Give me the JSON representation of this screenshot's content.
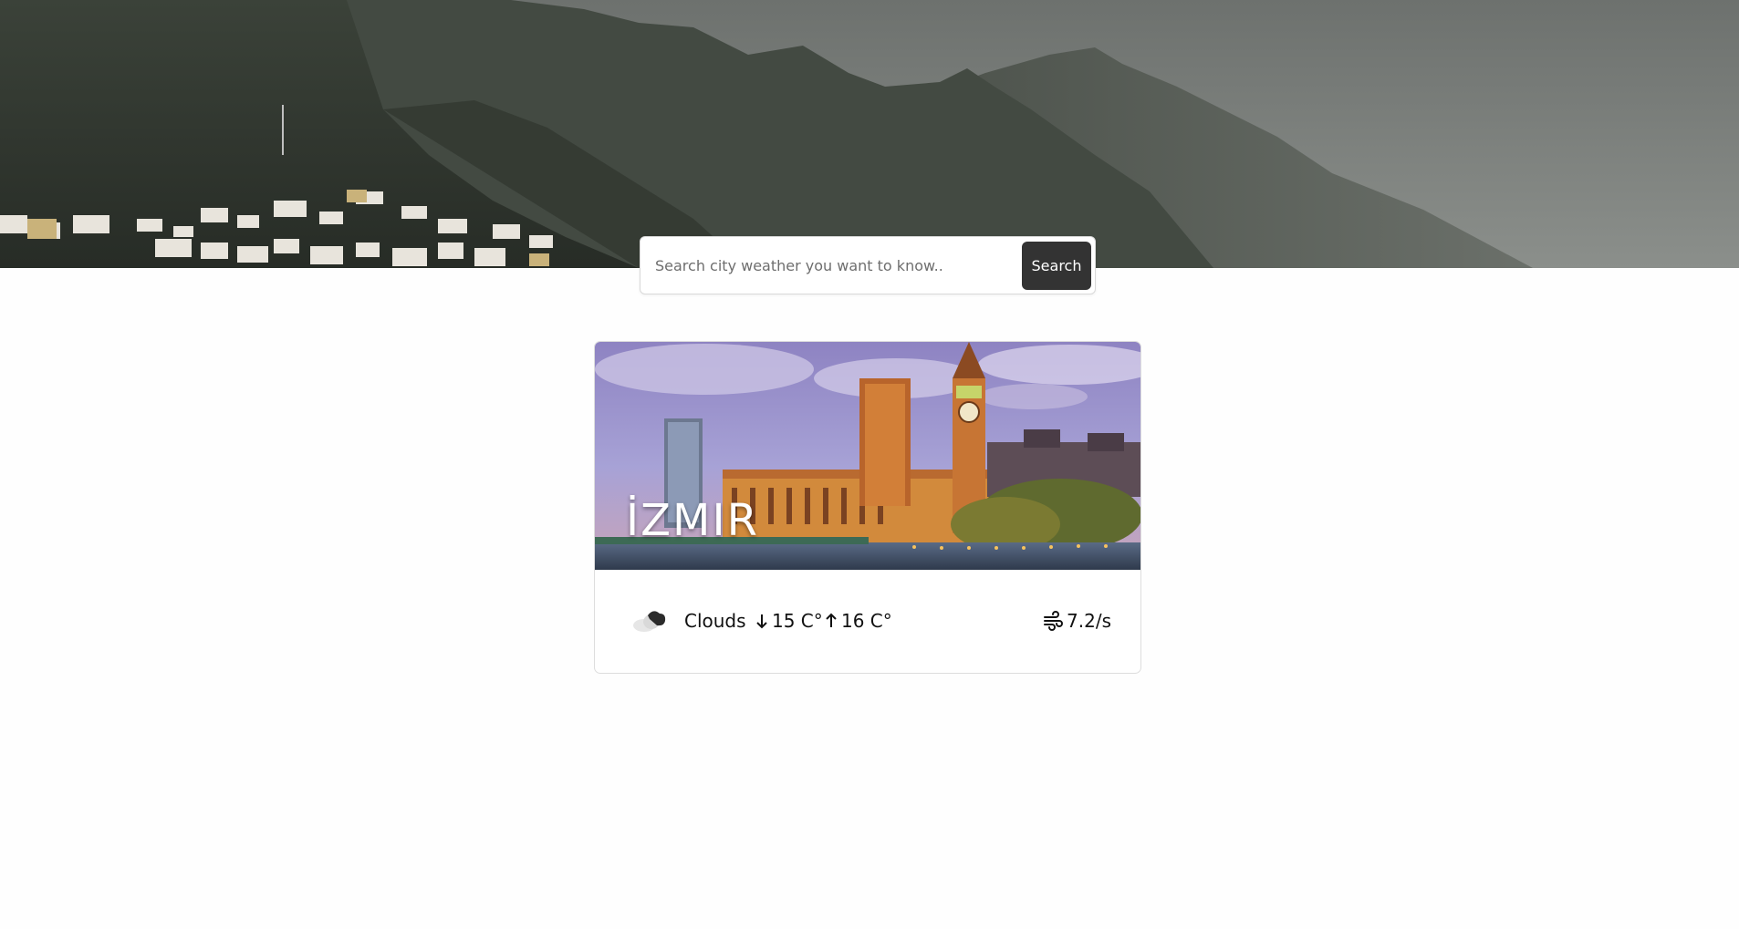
{
  "search": {
    "placeholder": "Search city weather you want to know..",
    "value": "",
    "button_label": "Search"
  },
  "card": {
    "city": "İZMIR",
    "description": "Clouds",
    "icon": "cloud-icon",
    "temp_min": "15 C°",
    "temp_max": "16 C°",
    "wind": "7.2/s"
  },
  "colors": {
    "button_bg": "#333333",
    "button_text": "#ffffff",
    "page_bg": "#fefefe",
    "card_border": "#dddddd"
  }
}
